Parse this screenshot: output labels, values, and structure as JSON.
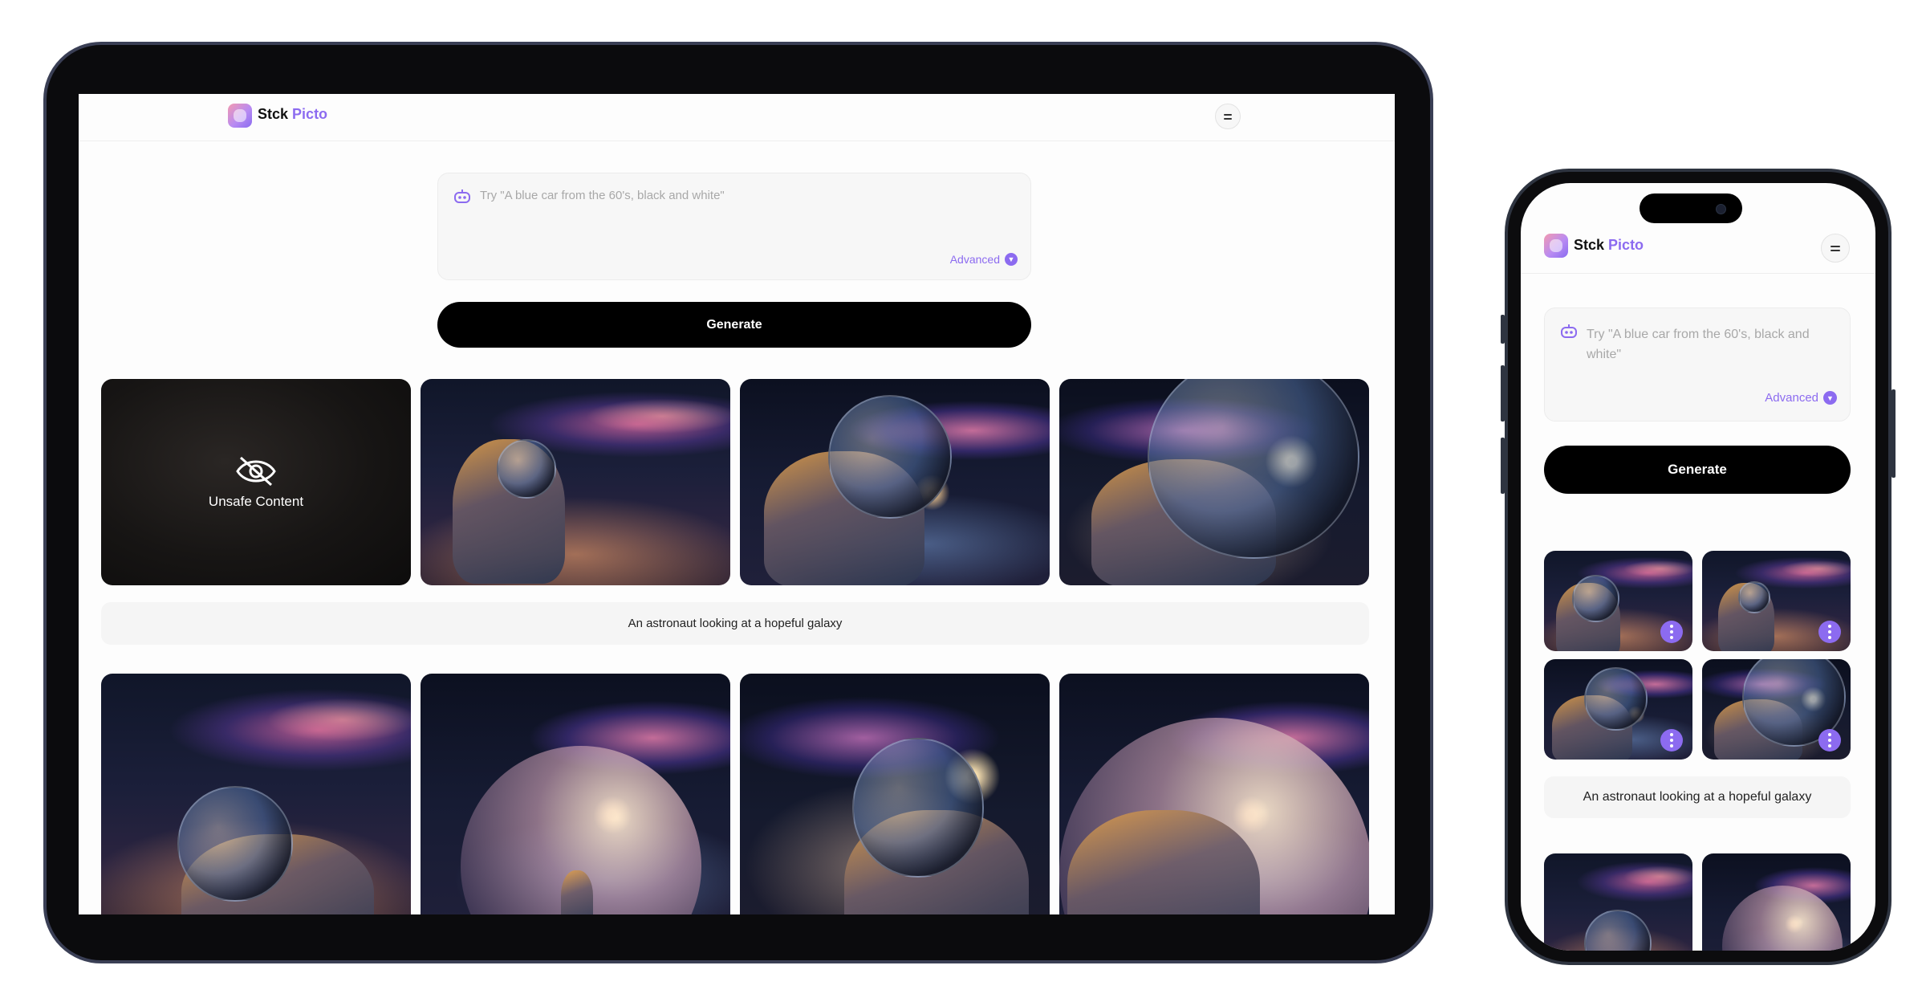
{
  "brand": {
    "name_part1": "Stck",
    "name_part2": "Picto",
    "accent_color": "#8c6bf0"
  },
  "prompt": {
    "placeholder": "Try \"A blue car from the 60's, black and white\"",
    "advanced_label": "Advanced"
  },
  "generate_label": "Generate",
  "tablet": {
    "unsafe_label": "Unsafe Content",
    "caption": "An astronaut looking at a hopeful galaxy"
  },
  "phone": {
    "caption": "An astronaut looking at a hopeful galaxy"
  },
  "icons": {
    "prompt": "robot-icon",
    "advanced": "chevron-down-icon",
    "menu": "menu-icon",
    "unsafe": "eye-off-icon",
    "tile_menu": "more-vertical-icon"
  }
}
